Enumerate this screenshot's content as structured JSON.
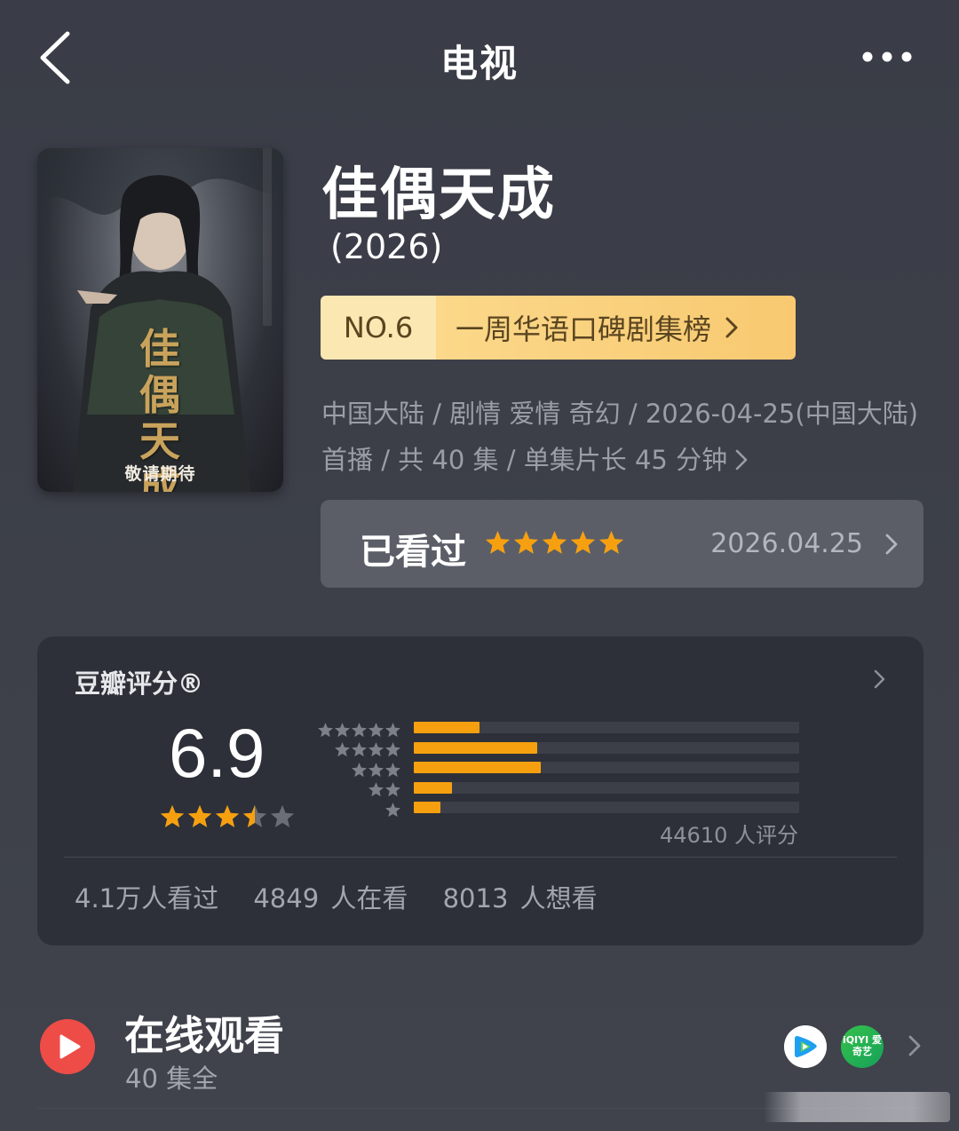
{
  "nav": {
    "title": "电视"
  },
  "show": {
    "title": "佳偶天成",
    "year": "(2026)",
    "poster_caption": "敬请期待",
    "poster_calligraphy": "佳偶天成",
    "rank": {
      "number": "NO.6",
      "label": "一周华语口碑剧集榜"
    },
    "meta": "中国大陆 / 剧情 爱情 奇幻 / 2026-04-25(中国大陆) 首播 / 共 40 集 / 单集片长 45 分钟",
    "watched": {
      "label": "已看过",
      "stars": 5,
      "date": "2026.04.25"
    }
  },
  "rating": {
    "title": "豆瓣评分®",
    "score": "6.9",
    "stars": 3.5,
    "distribution": [
      {
        "stars": 5,
        "fraction": 0.17
      },
      {
        "stars": 4,
        "fraction": 0.32
      },
      {
        "stars": 3,
        "fraction": 0.33
      },
      {
        "stars": 2,
        "fraction": 0.1
      },
      {
        "stars": 1,
        "fraction": 0.07
      }
    ],
    "count": "44610 人评分",
    "stats": {
      "watched": "4.1万人看过",
      "watching": "4849 人在看",
      "want": "8013 人想看"
    }
  },
  "online": {
    "title": "在线观看",
    "subtitle": "40 集全",
    "platforms": [
      "tencent-video",
      "iqiyi"
    ],
    "iqiyi_label": "iQIYI 爱奇艺"
  },
  "colors": {
    "accent_orange": "#f7a00f",
    "badge_gold": "#f8c970",
    "play_red": "#ee4c47"
  }
}
